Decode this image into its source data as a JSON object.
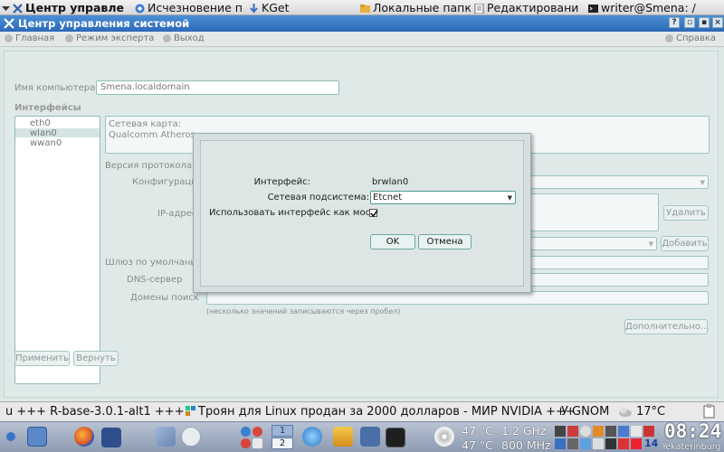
{
  "topbar": {
    "tasks": [
      {
        "label": "Центр управле",
        "active": true
      },
      {
        "label": "Исчезновение п"
      },
      {
        "label": "KGet"
      },
      {
        "label": "Локальные папк"
      },
      {
        "label": "Редактировани"
      },
      {
        "label": "writer@Smena: /"
      }
    ]
  },
  "window": {
    "title": "Центр управления системой",
    "buttons": {
      "help": "?",
      "minimize": "▫",
      "maximize": "▪",
      "close": "×"
    }
  },
  "menubar": {
    "home": "Главная",
    "expert": "Режим эксперта",
    "exit": "Выход",
    "help": "Справка"
  },
  "form": {
    "hostname_label": "Имя компьютера:",
    "hostname_value": "Smena.localdomain",
    "interfaces_header": "Интерфейсы",
    "interfaces": [
      "eth0",
      "wlan0",
      "wwan0"
    ],
    "selected_interface": 1,
    "card_label": "Сетевая карта:",
    "card_value": "Qualcomm Atheros",
    "protocol_label": "Версия протокола I",
    "config_label": "Конфигураци",
    "ip_label": "IP-адрес",
    "gateway_label": "Шлюз по умолчани",
    "dns_label": "DNS-сервер",
    "search_label": "Домены поиск",
    "hint": "(несколько значений записываются через пробел)",
    "delete_button": "Удалить",
    "add_button": "Добавить",
    "more_button": "Дополнительно...",
    "apply_button": "Применить",
    "revert_button": "Вернуть"
  },
  "dialog": {
    "interface_label": "Интерфейс:",
    "interface_value": "brwlan0",
    "subsystem_label": "Сетевая подсистема:",
    "subsystem_value": "Etcnet",
    "bridge_label": "Использовать интерфейс как мост",
    "bridge_checked": true,
    "ok_button": "OK",
    "cancel_button": "Отмена"
  },
  "ticker": {
    "text": "u +++  R-base-3.0.1-alt1 +++ ",
    "text2": "Троян для Linux продан за 2000 долларов - МИР NVIDIA +++",
    "text3": "У GNOM",
    "weather": "17°C"
  },
  "panel": {
    "workspaces": [
      "1",
      "2"
    ],
    "cpu_temp_1": "47 °C",
    "cpu_freq_1": "1.2 GHz",
    "cpu_temp_2": "47 °C",
    "cpu_freq_2": "800 MHz",
    "badge": "14",
    "time": "08:24",
    "city": "Yekaterinburg"
  }
}
